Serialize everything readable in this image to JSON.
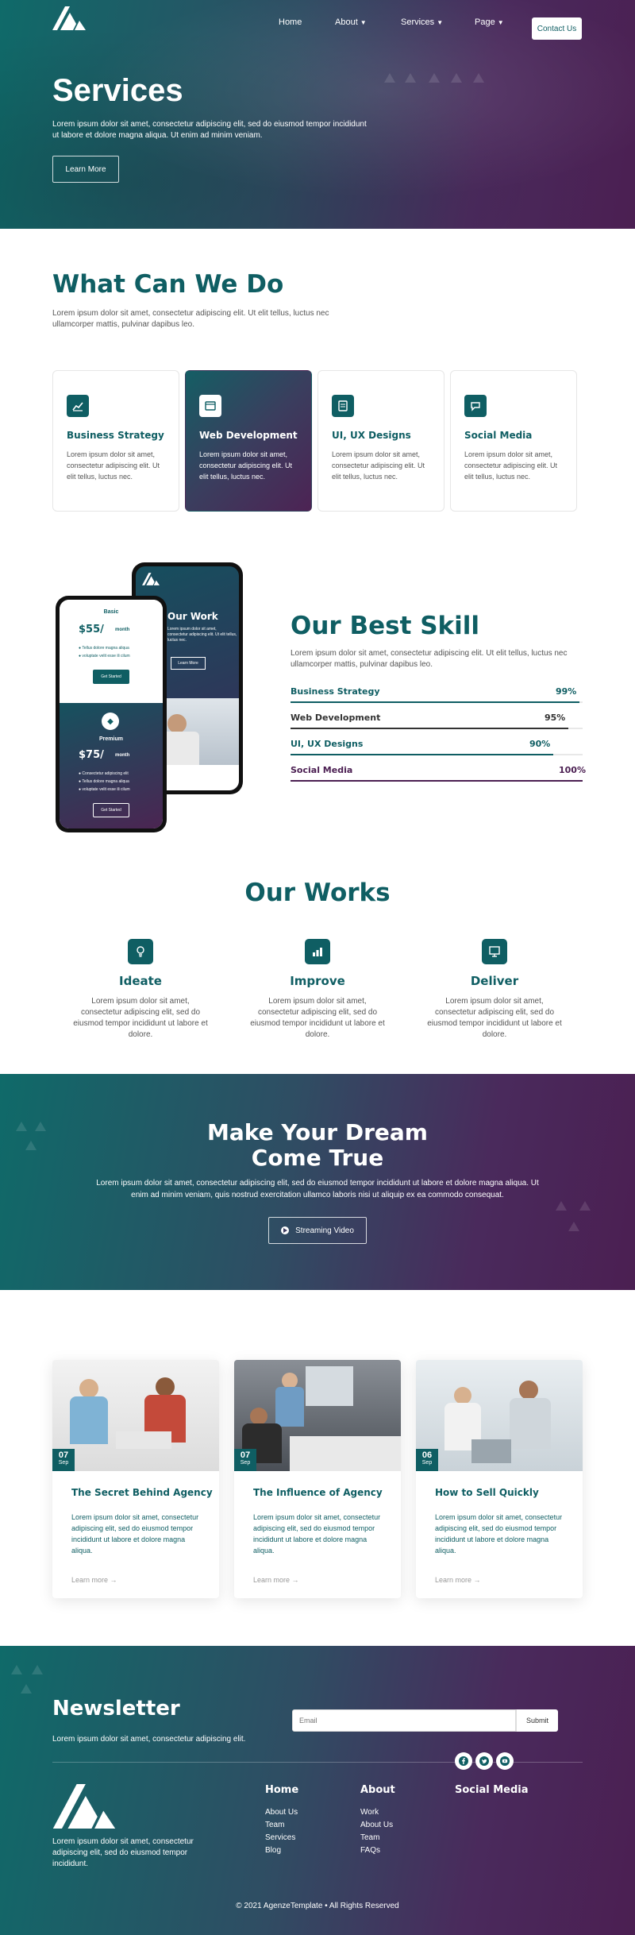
{
  "brand": {
    "logo_icon": "agenze-logo-icon"
  },
  "nav": {
    "home": "Home",
    "about": "About",
    "services": "Services",
    "page": "Page",
    "contact": "Contact Us"
  },
  "hero": {
    "title": "Services",
    "text": "Lorem ipsum dolor sit amet, consectetur adipiscing elit, sed do eiusmod tempor incididunt ut labore et dolore magna aliqua. Ut enim ad minim veniam.",
    "button": "Learn More"
  },
  "what": {
    "title": "What Can We Do",
    "text": "Lorem ipsum dolor sit amet, consectetur adipiscing elit. Ut elit tellus, luctus nec ullamcorper mattis, pulvinar dapibus leo.",
    "cards": [
      {
        "title": "Business Strategy",
        "text": "Lorem ipsum dolor sit amet, consectetur adipiscing elit. Ut elit tellus, luctus nec.",
        "icon": "chart-icon"
      },
      {
        "title": "Web Development",
        "text": "Lorem ipsum dolor sit amet, consectetur adipiscing elit. Ut elit tellus, luctus nec.",
        "icon": "browser-icon"
      },
      {
        "title": "UI, UX Designs",
        "text": "Lorem ipsum dolor sit amet, consectetur adipiscing elit. Ut elit tellus, luctus nec.",
        "icon": "design-icon"
      },
      {
        "title": "Social Media",
        "text": "Lorem ipsum dolor sit amet, consectetur adipiscing elit. Ut elit tellus, luctus nec.",
        "icon": "share-icon"
      }
    ]
  },
  "phones": {
    "front": {
      "basic_label": "Basic",
      "basic_price": "$55/",
      "basic_period": "month",
      "basic_items": [
        "Tellus dolore magna aliqua",
        "voluptate velit esse ili cilum"
      ],
      "basic_button": "Get Started",
      "premium_label": "Premium",
      "premium_price": "$75/",
      "premium_period": "month",
      "premium_items": [
        "Consectetur adipiscing elit",
        "Tellus dolore magna aliqua",
        "voluptate velit esse ili cilum"
      ],
      "premium_button": "Get Started"
    },
    "back": {
      "title": "Our Work",
      "text": "Lorem ipsum dolor sit amet, consectetur adipiscing elit. Ut elit tellus, luctus nec.",
      "button": "Learn More"
    }
  },
  "skill": {
    "title": "Our Best Skill",
    "text": "Lorem ipsum dolor sit amet, consectetur adipiscing elit. Ut elit tellus, luctus nec ullamcorper mattis, pulvinar dapibus leo.",
    "items": [
      {
        "label": "Business Strategy",
        "pct": "99%",
        "value": 0.99,
        "color": "#0f5e63"
      },
      {
        "label": "Web Development",
        "pct": "95%",
        "value": 0.95,
        "color": "#333333"
      },
      {
        "label": "UI, UX Designs",
        "pct": "90%",
        "value": 0.9,
        "color": "#0f5e63"
      },
      {
        "label": "Social Media",
        "pct": "100%",
        "value": 1.0,
        "color": "#4b1f52"
      }
    ]
  },
  "works": {
    "title": "Our Works",
    "items": [
      {
        "title": "Ideate",
        "text": "Lorem ipsum dolor sit amet, consectetur adipiscing elit, sed do eiusmod tempor incididunt ut labore et dolore.",
        "icon": "lightbulb-icon"
      },
      {
        "title": "Improve",
        "text": "Lorem ipsum dolor sit amet, consectetur adipiscing elit, sed do eiusmod tempor incididunt ut labore et dolore.",
        "icon": "bar-chart-icon"
      },
      {
        "title": "Deliver",
        "text": "Lorem ipsum dolor sit amet, consectetur adipiscing elit, sed do eiusmod tempor incididunt ut labore et dolore.",
        "icon": "presentation-icon"
      }
    ]
  },
  "dream": {
    "title_line1": "Make Your Dream",
    "title_line2": "Come True",
    "text": "Lorem ipsum dolor sit amet, consectetur adipiscing elit, sed do eiusmod tempor incididunt ut labore et dolore magna aliqua. Ut enim ad minim veniam, quis nostrud exercitation ullamco laboris nisi ut aliquip ex ea commodo consequat.",
    "button": "Streaming Video"
  },
  "posts": [
    {
      "day": "07",
      "month": "Sep",
      "title": "The Secret Behind Agency",
      "text": "Lorem ipsum dolor sit amet, consectetur adipiscing elit, sed do eiusmod tempor incididunt ut labore et dolore magna aliqua.",
      "more": "Learn more"
    },
    {
      "day": "07",
      "month": "Sep",
      "title": "The Influence of Agency",
      "text": "Lorem ipsum dolor sit amet, consectetur adipiscing elit, sed do eiusmod tempor incididunt ut labore et dolore magna aliqua.",
      "more": "Learn more"
    },
    {
      "day": "06",
      "month": "Sep",
      "title": "How to Sell Quickly",
      "text": "Lorem ipsum dolor sit amet, consectetur adipiscing elit, sed do eiusmod tempor incididunt ut labore et dolore magna aliqua.",
      "more": "Learn more"
    }
  ],
  "footer": {
    "newsletter_title": "Newsletter",
    "newsletter_text": "Lorem ipsum dolor sit amet, consectetur adipiscing elit.",
    "email_placeholder": "Email",
    "submit": "Submit",
    "about_text": "Lorem ipsum dolor sit amet, consectetur adipiscing elit, sed do eiusmod tempor incididunt.",
    "home_title": "Home",
    "home_links": [
      "About Us",
      "Team",
      "Services",
      "Blog"
    ],
    "about_title": "About",
    "about_links": [
      "Work",
      "About Us",
      "Team",
      "FAQs"
    ],
    "social_title": "Social Media",
    "social_icons": [
      "facebook-icon",
      "twitter-icon",
      "youtube-icon"
    ],
    "copyright": "© 2021 AgenzeTemplate • All Rights Reserved"
  }
}
